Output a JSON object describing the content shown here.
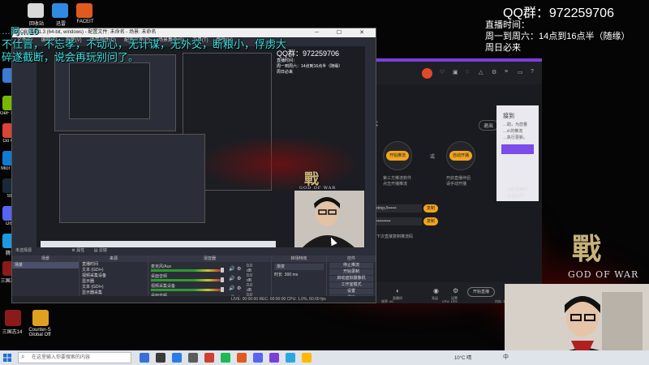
{
  "desktop": {
    "top_icons": [
      {
        "label": "回收站",
        "color": "#d8d8d8"
      },
      {
        "label": "迅雷",
        "color": "#2f8ae0"
      },
      {
        "label": "FACEIT",
        "color": "#e05a1f"
      }
    ],
    "left_icons": [
      {
        "label": "",
        "color": "#3a7bd5"
      },
      {
        "label": "GeF Experi",
        "color": "#76b900"
      },
      {
        "label": "Go Chr",
        "color": "#db4437"
      },
      {
        "label": "Micr Edg",
        "color": "#0f7bd4"
      },
      {
        "label": "Ste",
        "color": "#1b2838"
      },
      {
        "label": "Disc",
        "color": "#5865f2"
      },
      {
        "label": "腾讯",
        "color": "#1a9be0"
      },
      {
        "label": "三国志14",
        "color": "#8b1a1a"
      }
    ],
    "bottom_icons": [
      {
        "label": "三国志14",
        "color": "#8b1a1a"
      },
      {
        "label": "Counter-S Global Off",
        "color": "#e0a020"
      }
    ]
  },
  "overlay": {
    "line1": "…阿…10",
    "line2": "不仕晋，不忘孝，不动心，无计谋，无外交，断粮小，俘虏大",
    "line3": "碎遂截断，说会再玩别问了。",
    "qq_group": "QQ群：972259706",
    "schedule_title": "直播时间：",
    "schedule_line1": "周一到周六：14点到16点半（随缘）",
    "schedule_line2": "周日必来"
  },
  "obs": {
    "title": "OBS 27.1.3 (64-bit, windows) - 配置文件: 未命名 - 场景: 未命名",
    "menu": [
      "文件(F)",
      "编辑(E)",
      "视图(V)",
      "停靠部件(D)",
      "配置文件(P)",
      "场景集合(S)",
      "工具(T)",
      "帮助(H)"
    ],
    "preview": {
      "qq_group": "QQ群：972259706",
      "schedule_title": "直播时间：",
      "schedule_line1": "周一到周六：14点到16点半（随缘）",
      "schedule_line2": "周日必来"
    },
    "toolbar_label": "未选择源",
    "toolbar_props": "属性",
    "toolbar_filters": "滤镜",
    "docks": {
      "scenes_header": "场景",
      "scenes": [
        "场景"
      ],
      "sources_header": "来源",
      "sources": [
        "直播时间",
        "文本 (GDI+)",
        "视频采集设备",
        "显示器",
        "文本 (GDI+)",
        "显示器采集"
      ],
      "mixer_header": "混音器",
      "mixer": [
        {
          "name": "麦克风/Aux",
          "db": "0.0 dB"
        },
        {
          "name": "桌面音频",
          "db": "0.0 dB"
        },
        {
          "name": "视频采集设备",
          "db": "0.0 dB"
        },
        {
          "name": "桌面音频",
          "db": "0.0 dB"
        }
      ],
      "transitions_header": "转场特效",
      "transition_type": "渐变",
      "duration_label": "时长",
      "duration_value": "300 ms",
      "controls_header": "控件",
      "controls": [
        "停止推流",
        "开始录制",
        "启动虚拟摄像机",
        "工作室模式",
        "设置",
        "退出"
      ]
    },
    "status": "LIVE: 00:00:00    REC: 00:00:00    CPU: 1.0%, 60.00 fps"
  },
  "client": {
    "mode_title": "模式",
    "exit_label": "退出",
    "mode_left_btn": "开始推流",
    "mode_right_btn": "自动开播",
    "mode_left_desc": "第三方推流软件",
    "mode_left_desc2": "点击开播推流",
    "mode_right_desc": "开启直播伴侣",
    "mode_right_desc2": "请手动开播",
    "vs_label": "或",
    "field1": "rtmp://••••••",
    "field2": "••••••••••",
    "copy_label": "复制",
    "bottom_note": "下次直接复制推流码",
    "bottom_icons": [
      {
        "icon": "◐",
        "label": "直播间"
      },
      {
        "icon": "◉",
        "label": "耳返"
      },
      {
        "icon": "⚙",
        "label": "设置"
      }
    ],
    "start_live": "开始直播",
    "stats": [
      "帧率: 60",
      "CPU: 15%",
      "内存: 3%"
    ]
  },
  "right_panel": {
    "title": "接到",
    "lines": [
      "…助，为您量",
      "…d 的推流",
      "…执行更新。"
    ],
    "footer1": "…当前直播间",
    "footer2": "…示在此页！"
  },
  "gow": {
    "char": "戰",
    "text": "GOD OF WAR"
  },
  "taskbar": {
    "search_placeholder": "在这里输入你要搜索的内容",
    "weather": "10°C 晴",
    "clock": "中",
    "apps": [
      "#3a6fd8",
      "#3a3a3a",
      "#2a7de1",
      "#5c5c5c",
      "#d04030",
      "#1db954",
      "#e05a1f",
      "#5865f2",
      "#7b3fd8",
      "#2aa8e0",
      "#ffb900"
    ]
  }
}
